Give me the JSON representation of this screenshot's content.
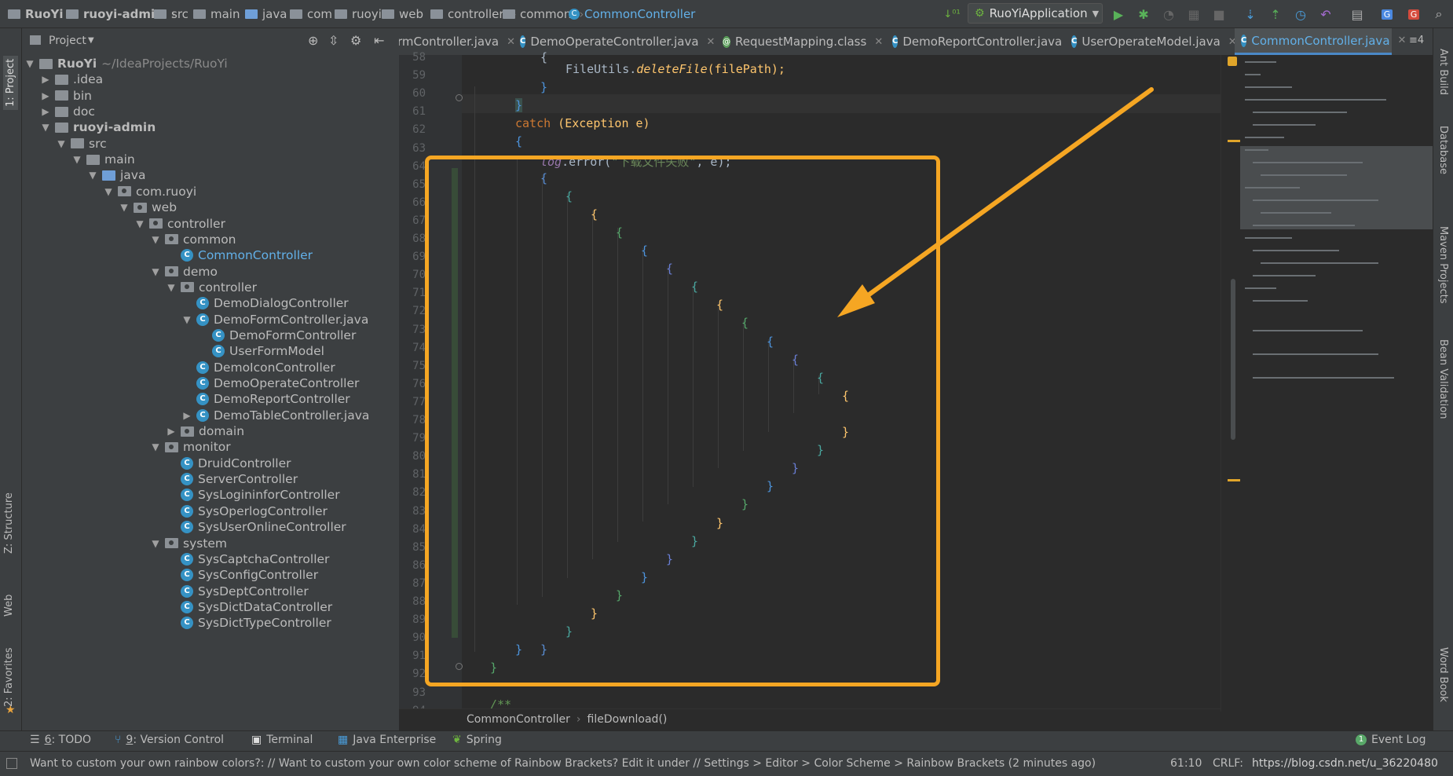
{
  "breadcrumbs": [
    {
      "label": "RuoYi",
      "icon": "folder-icon",
      "bold": true
    },
    {
      "label": "ruoyi-admin",
      "icon": "folder-icon",
      "bold": true
    },
    {
      "label": "src",
      "icon": "folder-icon"
    },
    {
      "label": "main",
      "icon": "folder-icon"
    },
    {
      "label": "java",
      "icon": "source-folder-icon"
    },
    {
      "label": "com",
      "icon": "package-icon"
    },
    {
      "label": "ruoyi",
      "icon": "package-icon"
    },
    {
      "label": "web",
      "icon": "package-icon"
    },
    {
      "label": "controller",
      "icon": "package-icon"
    },
    {
      "label": "common",
      "icon": "package-icon"
    },
    {
      "label": "CommonController",
      "icon": "class-icon",
      "selected": true
    }
  ],
  "toolbar": {
    "run_config": "RuoYiApplication",
    "sort_label": "01\n10"
  },
  "left_stripe": {
    "project": "1: Project",
    "structure": "Z: Structure",
    "web": "Web",
    "favorites": "2: Favorites"
  },
  "right_stripe": {
    "ant": "Ant Build",
    "database": "Database",
    "maven": "Maven Projects",
    "bean": "Bean Validation",
    "wordbook": "Word Book"
  },
  "project_panel": {
    "title": "Project"
  },
  "tree": [
    {
      "label": "RuoYi",
      "suffix": "~/IdeaProjects/RuoYi",
      "icon": "folder",
      "expanded": true,
      "bold": true
    },
    {
      "label": ".idea",
      "icon": "folder",
      "expanded": false
    },
    {
      "label": "bin",
      "icon": "folder",
      "expanded": false
    },
    {
      "label": "doc",
      "icon": "folder",
      "expanded": false
    },
    {
      "label": "ruoyi-admin",
      "icon": "folder",
      "expanded": true,
      "bold": true
    },
    {
      "label": "src",
      "icon": "folder",
      "expanded": true
    },
    {
      "label": "main",
      "icon": "folder",
      "expanded": true
    },
    {
      "label": "java",
      "icon": "src",
      "expanded": true
    },
    {
      "label": "com.ruoyi",
      "icon": "pkg",
      "expanded": true
    },
    {
      "label": "web",
      "icon": "pkg",
      "expanded": true
    },
    {
      "label": "controller",
      "icon": "pkg",
      "expanded": true
    },
    {
      "label": "common",
      "icon": "pkg",
      "expanded": true
    },
    {
      "label": "CommonController",
      "icon": "class",
      "current": true
    },
    {
      "label": "demo",
      "icon": "pkg",
      "expanded": true
    },
    {
      "label": "controller",
      "icon": "pkg",
      "expanded": true
    },
    {
      "label": "DemoDialogController",
      "icon": "class"
    },
    {
      "label": "DemoFormController.java",
      "icon": "class",
      "expanded": true
    },
    {
      "label": "DemoFormController",
      "icon": "class"
    },
    {
      "label": "UserFormModel",
      "icon": "class"
    },
    {
      "label": "DemoIconController",
      "icon": "class"
    },
    {
      "label": "DemoOperateController",
      "icon": "class"
    },
    {
      "label": "DemoReportController",
      "icon": "class"
    },
    {
      "label": "DemoTableController.java",
      "icon": "class",
      "expanded": false
    },
    {
      "label": "domain",
      "icon": "pkg",
      "expanded": false
    },
    {
      "label": "monitor",
      "icon": "pkg",
      "expanded": true
    },
    {
      "label": "DruidController",
      "icon": "class"
    },
    {
      "label": "ServerController",
      "icon": "class"
    },
    {
      "label": "SysLogininforController",
      "icon": "class"
    },
    {
      "label": "SysOperlogController",
      "icon": "class"
    },
    {
      "label": "SysUserOnlineController",
      "icon": "class"
    },
    {
      "label": "system",
      "icon": "pkg",
      "expanded": true
    },
    {
      "label": "SysCaptchaController",
      "icon": "class"
    },
    {
      "label": "SysConfigController",
      "icon": "class"
    },
    {
      "label": "SysDeptController",
      "icon": "class"
    },
    {
      "label": "SysDictDataController",
      "icon": "class"
    },
    {
      "label": "SysDictTypeController",
      "icon": "class"
    }
  ],
  "tabs": [
    {
      "label": "rmController.java",
      "icon": "class-icon"
    },
    {
      "label": "DemoOperateController.java",
      "icon": "class-icon"
    },
    {
      "label": "RequestMapping.class",
      "icon": "annotation-icon"
    },
    {
      "label": "DemoReportController.java",
      "icon": "class-icon"
    },
    {
      "label": "UserOperateModel.java",
      "icon": "class-icon"
    },
    {
      "label": "CommonController.java",
      "icon": "class-icon",
      "active": true
    }
  ],
  "tab_overflow": "≡4",
  "line_numbers": [
    "58",
    "59",
    "60",
    "61",
    "62",
    "63",
    "64",
    "65",
    "66",
    "67",
    "68",
    "69",
    "70",
    "71",
    "72",
    "73",
    "74",
    "75",
    "76",
    "77",
    "78",
    "79",
    "80",
    "81",
    "82",
    "83",
    "84",
    "85",
    "86",
    "87",
    "88",
    "89",
    "90",
    "91",
    "92",
    "93",
    "94"
  ],
  "code": {
    "l59_cls": "FileUtils.",
    "l59_fn": "deleteFile",
    "l59_rest": "(filePath);",
    "l62_kw": "catch",
    "l62_rest": " (Exception e)",
    "l64_log": "log",
    "l64_mid": ".error(",
    "l64_str": "\"下载文件失败\"",
    "l64_end": ", e);",
    "l94": "/**"
  },
  "bracket_colors": [
    "#ffc66d",
    "#4d94dd",
    "#5a8fd6",
    "#4aa8a0",
    "#56a86b",
    "#e0c64b"
  ],
  "editor_breadcrumb": {
    "cls": "CommonController",
    "method": "fileDownload()"
  },
  "bottom_tabs": [
    {
      "num": "6",
      "label": ": TODO"
    },
    {
      "num": "9",
      "label": ": Version Control"
    },
    {
      "num": "",
      "label": "Terminal"
    },
    {
      "num": "",
      "label": "Java Enterprise"
    },
    {
      "num": "",
      "label": "Spring"
    }
  ],
  "event_log": "Event Log",
  "status": {
    "message": "Want to custom your own rainbow colors?: //    Want to custom your own color scheme of Rainbow Brackets? Edit it under //    Settings > Editor > Color Scheme > Rainbow Brackets    (2 minutes ago)",
    "position": "61:10",
    "line_sep": "CRLF:",
    "watermark": "https://blog.csdn.net/u_36220480"
  }
}
